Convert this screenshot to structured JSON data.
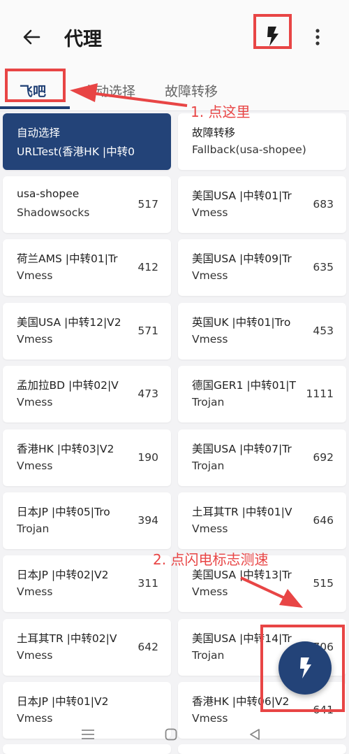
{
  "header": {
    "title": "代理",
    "back_icon": "arrow-left-icon",
    "test_icon": "lightning-bolt-icon",
    "menu_icon": "more-vertical-icon"
  },
  "tabs": [
    {
      "label": "飞吧",
      "active": true
    },
    {
      "label": "自动选择",
      "active": false
    },
    {
      "label": "故障转移",
      "active": false
    }
  ],
  "proxies": [
    {
      "name": "自动选择",
      "type": "URLTest(香港HK |中转0",
      "delay": "",
      "selected": true
    },
    {
      "name": "故障转移",
      "type": "Fallback(usa-shopee)",
      "delay": "",
      "selected": false
    },
    {
      "name": "usa-shopee",
      "type": "Shadowsocks",
      "delay": "517"
    },
    {
      "name": "美国USA |中转01|Tr",
      "type": "Vmess",
      "delay": "683"
    },
    {
      "name": "荷兰AMS |中转01|Tr",
      "type": "Vmess",
      "delay": "412"
    },
    {
      "name": "美国USA |中转09|Tr",
      "type": "Vmess",
      "delay": "635"
    },
    {
      "name": "美国USA |中转12|V2",
      "type": "Vmess",
      "delay": "571"
    },
    {
      "name": "英国UK |中转01|Tro",
      "type": "Vmess",
      "delay": "453"
    },
    {
      "name": "孟加拉BD |中转02|V",
      "type": "Vmess",
      "delay": "473"
    },
    {
      "name": "德国GER1 |中转01|T",
      "type": "Trojan",
      "delay": "1111"
    },
    {
      "name": "香港HK |中转03|V2",
      "type": "Vmess",
      "delay": "190"
    },
    {
      "name": "美国USA |中转07|Tr",
      "type": "Trojan",
      "delay": "692"
    },
    {
      "name": "日本JP |中转05|Tro",
      "type": "Trojan",
      "delay": "394"
    },
    {
      "name": "土耳其TR |中转01|V",
      "type": "Vmess",
      "delay": "646"
    },
    {
      "name": "日本JP |中转02|V2",
      "type": "Vmess",
      "delay": "311"
    },
    {
      "name": "美国USA |中转13|Tr",
      "type": "Vmess",
      "delay": "515"
    },
    {
      "name": "土耳其TR |中转02|V",
      "type": "Vmess",
      "delay": "642"
    },
    {
      "name": "美国USA |中转14|Tr",
      "type": "Trojan",
      "delay": "706"
    },
    {
      "name": "日本JP |中转01|V2",
      "type": "Vmess",
      "delay": ""
    },
    {
      "name": "香港HK |中转06|V2",
      "type": "Vmess",
      "delay": "641"
    }
  ],
  "fab": {
    "icon": "lightning-bolt-icon"
  },
  "annotations": {
    "step1": "1. 点这里",
    "step2": "2. 点闪电标志测速",
    "color": "#e84545"
  },
  "navbar": {
    "icons": [
      "menu-lines-icon",
      "home-square-icon",
      "back-triangle-icon"
    ]
  },
  "colors": {
    "accent": "#234378",
    "background": "#f3f3f5",
    "annotation": "#e84545"
  }
}
